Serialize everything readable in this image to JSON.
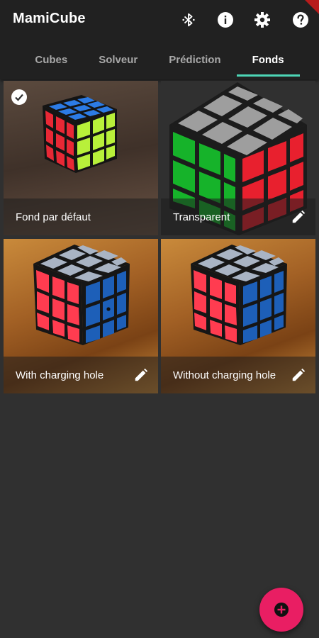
{
  "app": {
    "title": "MamiCube",
    "actions": [
      {
        "icon": "bluetooth-icon"
      },
      {
        "icon": "info-icon"
      },
      {
        "icon": "settings-gear-icon"
      },
      {
        "icon": "help-icon"
      }
    ]
  },
  "tabs": [
    {
      "label": "Cubes",
      "active": false
    },
    {
      "label": "Solveur",
      "active": false
    },
    {
      "label": "Prédiction",
      "active": false
    },
    {
      "label": "Fonds",
      "active": true
    }
  ],
  "backgrounds": [
    {
      "label": "Fond par défaut",
      "selected": true,
      "editable": false
    },
    {
      "label": "Transparent",
      "selected": false,
      "editable": true
    },
    {
      "label": "With charging hole",
      "selected": false,
      "editable": true
    },
    {
      "label": "Without charging hole",
      "selected": false,
      "editable": true
    }
  ],
  "colors": {
    "accent": "#4dd6b6",
    "fab": "#e91e63",
    "appbar": "#212121",
    "background": "#303030"
  },
  "fab": {
    "icon": "add-circle-icon"
  }
}
